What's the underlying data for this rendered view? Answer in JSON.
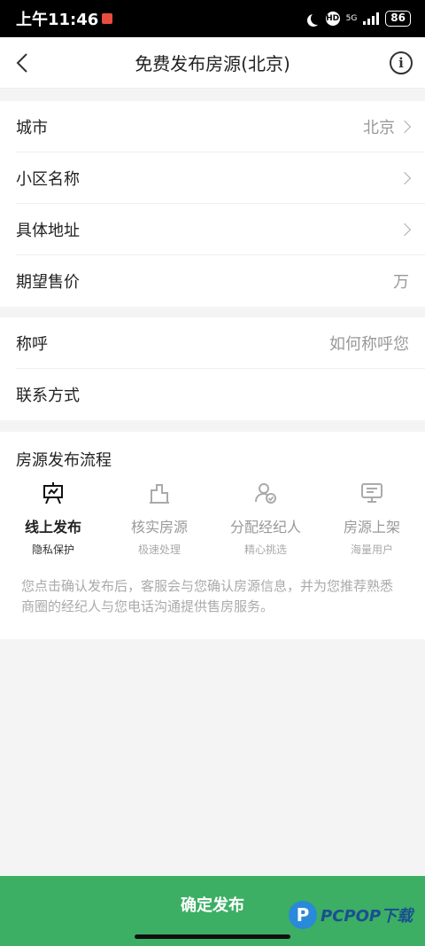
{
  "status_bar": {
    "time": "上午11:46",
    "network": "5G",
    "battery": "86"
  },
  "header": {
    "title": "免费发布房源(北京)"
  },
  "property_fields": [
    {
      "label": "城市",
      "value": "北京"
    },
    {
      "label": "小区名称",
      "value": ""
    },
    {
      "label": "具体地址",
      "value": ""
    },
    {
      "label": "期望售价",
      "value": "万"
    }
  ],
  "contact_fields": [
    {
      "label": "称呼",
      "placeholder": "如何称呼您"
    },
    {
      "label": "联系方式",
      "placeholder": ""
    }
  ],
  "process": {
    "title": "房源发布流程",
    "steps": [
      {
        "name": "线上发布",
        "sub": "隐私保护",
        "icon": "presentation-board-icon"
      },
      {
        "name": "核实房源",
        "sub": "极速处理",
        "icon": "building-icon"
      },
      {
        "name": "分配经纪人",
        "sub": "精心挑选",
        "icon": "user-check-icon"
      },
      {
        "name": "房源上架",
        "sub": "海量用户",
        "icon": "monitor-icon"
      }
    ],
    "description": "您点击确认发布后，客服会与您确认房源信息，并为您推荐熟悉商圈的经纪人与您电话沟通提供售房服务。"
  },
  "footer": {
    "confirm_label": "确定发布"
  },
  "watermark": {
    "text": "PCPOP下载"
  },
  "colors": {
    "accent": "#3caf64",
    "muted_text": "#999999"
  }
}
